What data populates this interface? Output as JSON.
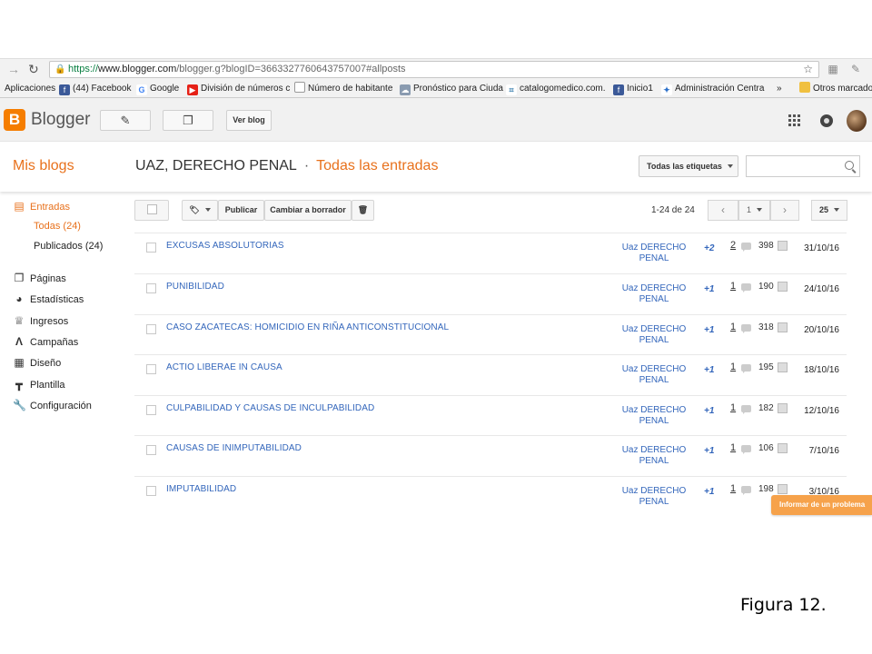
{
  "browser": {
    "url_https": "https://",
    "url_host": "www.blogger.com",
    "url_rest": "/blogger.g?blogID=3663327760643757007#allposts",
    "bookmarks": [
      {
        "label": "Aplicaciones",
        "icon": "apps-icon"
      },
      {
        "label": "(44) Facebook",
        "icon": "facebook-icon",
        "color": "#3b5998"
      },
      {
        "label": "Google",
        "icon": "google-icon",
        "color": "#4285f4"
      },
      {
        "label": "División de números c",
        "icon": "youtube-icon",
        "color": "#e62117"
      },
      {
        "label": "Número de habitante",
        "icon": "page-icon"
      },
      {
        "label": "Pronóstico para Ciuda",
        "icon": "weather-icon"
      },
      {
        "label": "catalogomedico.com.",
        "icon": "slack-icon"
      },
      {
        "label": "Inicio1",
        "icon": "facebook-icon",
        "color": "#3b5998"
      },
      {
        "label": "Administración Centra",
        "icon": "dropbox-icon"
      },
      {
        "label": "»",
        "icon": ""
      },
      {
        "label": "Otros marcado",
        "icon": "folder-icon",
        "color": "#f0c040"
      }
    ]
  },
  "header": {
    "brand": "Blogger",
    "view_blog_label": "Ver blog"
  },
  "titlebar": {
    "my_blogs": "Mis blogs",
    "blog_name": "UAZ, DERECHO PENAL",
    "separator": "·",
    "section": "Todas las entradas",
    "labels_filter": "Todas las etiquetas",
    "search_placeholder": ""
  },
  "sidebar": {
    "entries_label": "Entradas",
    "sub_all": "Todas (24)",
    "sub_published": "Publicados (24)",
    "items": [
      {
        "label": "Páginas",
        "icon": "pages-icon"
      },
      {
        "label": "Estadísticas",
        "icon": "stats-icon"
      },
      {
        "label": "Ingresos",
        "icon": "trophy-icon"
      },
      {
        "label": "Campañas",
        "icon": "campaigns-icon"
      },
      {
        "label": "Diseño",
        "icon": "layout-icon"
      },
      {
        "label": "Plantilla",
        "icon": "template-icon"
      },
      {
        "label": "Configuración",
        "icon": "settings-icon"
      }
    ]
  },
  "toolbar": {
    "publish_label": "Publicar",
    "revert_label": "Cambiar a borrador",
    "range_text": "1-24 de 24",
    "page_value": "1",
    "per_page_value": "25"
  },
  "posts": [
    {
      "title": "EXCUSAS ABSOLUTORIAS",
      "label": "Uaz DERECHO PENAL",
      "plus": "+2",
      "comments": "2",
      "views": "398",
      "date": "31/10/16"
    },
    {
      "title": "PUNIBILIDAD",
      "label": "Uaz DERECHO PENAL",
      "plus": "+1",
      "comments": "1",
      "views": "190",
      "date": "24/10/16"
    },
    {
      "title": "CASO ZACATECAS: HOMICIDIO EN RIÑA ANTICONSTITUCIONAL",
      "label": "Uaz DERECHO PENAL",
      "plus": "+1",
      "comments": "1",
      "views": "318",
      "date": "20/10/16"
    },
    {
      "title": "ACTIO LIBERAE IN CAUSA",
      "label": "Uaz DERECHO PENAL",
      "plus": "+1",
      "comments": "1",
      "views": "195",
      "date": "18/10/16"
    },
    {
      "title": "CULPABILIDAD Y CAUSAS DE INCULPABILIDAD",
      "label": "Uaz DERECHO PENAL",
      "plus": "+1",
      "comments": "1",
      "views": "182",
      "date": "12/10/16"
    },
    {
      "title": "CAUSAS DE INIMPUTABILIDAD",
      "label": "Uaz DERECHO PENAL",
      "plus": "+1",
      "comments": "1",
      "views": "106",
      "date": "7/10/16"
    },
    {
      "title": "IMPUTABILIDAD",
      "label": "Uaz DERECHO PENAL",
      "plus": "+1",
      "comments": "1",
      "views": "198",
      "date": "3/10/16"
    }
  ],
  "report_label": "Informar de un problema",
  "caption": "Figura 12."
}
